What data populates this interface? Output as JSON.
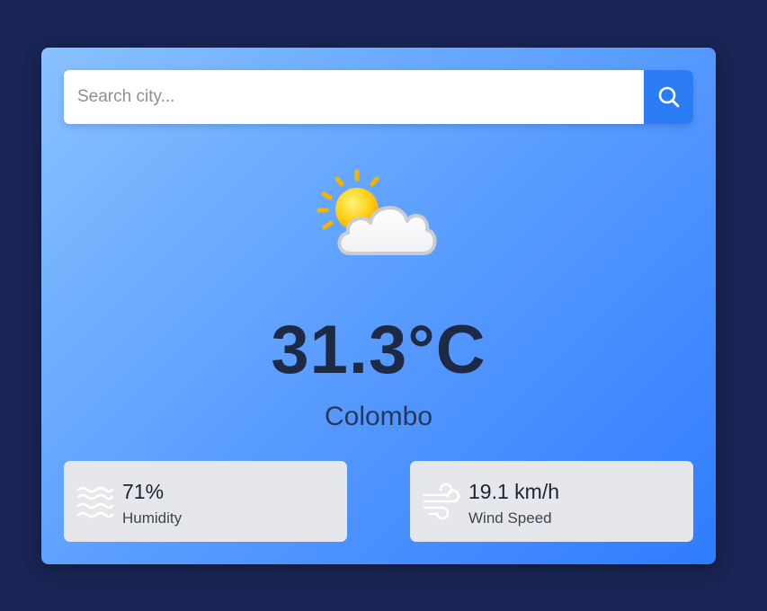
{
  "search": {
    "placeholder": "Search city...",
    "value": ""
  },
  "weather": {
    "icon": "partly-cloudy-icon",
    "temperature": "31.3°C",
    "city": "Colombo"
  },
  "stats": {
    "humidity": {
      "icon": "humidity-waves-icon",
      "value": "71%",
      "label": "Humidity"
    },
    "wind": {
      "icon": "wind-icon",
      "value": "19.1 km/h",
      "label": "Wind Speed"
    }
  },
  "colors": {
    "page_background": "#182453",
    "card_gradient_start": "#8ac1ff",
    "card_gradient_end": "#2f7cff",
    "search_button": "#2c7cf6",
    "stat_box": "#e6e7ea",
    "text_dark": "#1e2a44"
  }
}
